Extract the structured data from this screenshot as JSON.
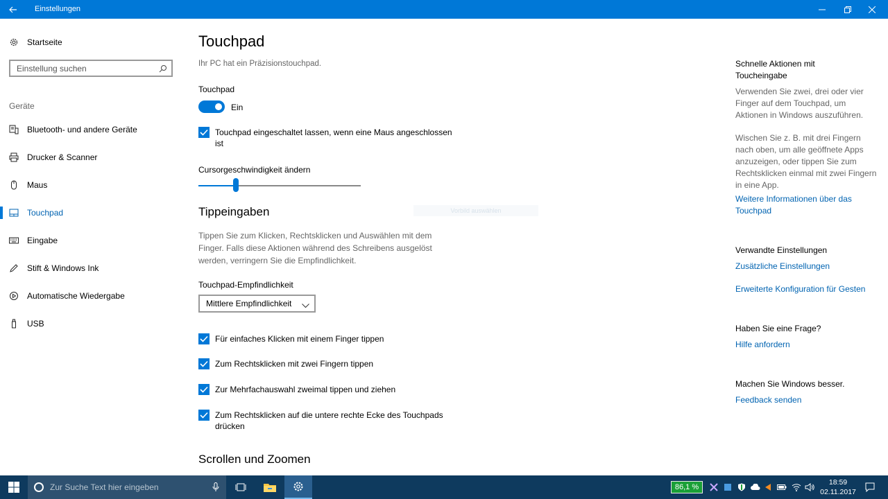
{
  "window": {
    "title": "Einstellungen"
  },
  "sidebar": {
    "home": "Startseite",
    "search_placeholder": "Einstellung suchen",
    "section": "Geräte",
    "items": [
      {
        "label": "Bluetooth- und andere Geräte",
        "icon": "bluetooth-devices-icon"
      },
      {
        "label": "Drucker & Scanner",
        "icon": "printer-icon"
      },
      {
        "label": "Maus",
        "icon": "mouse-icon"
      },
      {
        "label": "Touchpad",
        "icon": "touchpad-icon",
        "active": true
      },
      {
        "label": "Eingabe",
        "icon": "keyboard-icon"
      },
      {
        "label": "Stift & Windows Ink",
        "icon": "pen-icon"
      },
      {
        "label": "Automatische Wiedergabe",
        "icon": "autoplay-icon"
      },
      {
        "label": "USB",
        "icon": "usb-icon"
      }
    ]
  },
  "main": {
    "title": "Touchpad",
    "subtitle": "Ihr PC hat ein Präzisionstouchpad.",
    "touchpad_label": "Touchpad",
    "toggle_state": "Ein",
    "keep_on_label": "Touchpad eingeschaltet lassen, wenn eine Maus angeschlossen ist",
    "cursor_speed_label": "Cursorgeschwindigkeit ändern",
    "cursor_speed_value": 0.23,
    "tap_heading": "Tippeingaben",
    "tap_description": "Tippen Sie zum Klicken, Rechtsklicken und Auswählen mit dem Finger. Falls diese Aktionen während des Schreibens ausgelöst werden, verringern Sie die Empfindlichkeit.",
    "sensitivity_label": "Touchpad-Empfindlichkeit",
    "sensitivity_value": "Mittlere Empfindlichkeit",
    "ghost_text": "Vorbild auswählen",
    "checkboxes": [
      "Für einfaches Klicken mit einem Finger tippen",
      "Zum Rechtsklicken mit zwei Fingern tippen",
      "Zur Mehrfachauswahl zweimal tippen und ziehen",
      "Zum Rechtsklicken auf die untere rechte Ecke des Touchpads drücken"
    ],
    "scroll_heading": "Scrollen und Zoomen"
  },
  "right": {
    "quick_heading": "Schnelle Aktionen mit Toucheingabe",
    "quick_p1": "Verwenden Sie zwei, drei oder vier Finger auf dem Touchpad, um Aktionen in Windows auszuführen.",
    "quick_p2": "Wischen Sie z. B. mit drei Fingern nach oben, um alle geöffnete Apps anzuzeigen, oder tippen Sie zum Rechtsklicken einmal mit zwei Fingern in eine App.",
    "quick_link": "Weitere Informationen über das Touchpad",
    "related_heading": "Verwandte Einstellungen",
    "related_link1": "Zusätzliche Einstellungen",
    "related_link2": "Erweiterte Konfiguration für Gesten",
    "question_heading": "Haben Sie eine Frage?",
    "question_link": "Hilfe anfordern",
    "improve_heading": "Machen Sie Windows besser.",
    "improve_link": "Feedback senden"
  },
  "taskbar": {
    "search_placeholder": "Zur Suche Text hier eingeben",
    "battery": "86,1 %",
    "time": "18:59",
    "date": "02.11.2017"
  },
  "colors": {
    "accent": "#0078d7",
    "link": "#0063b1",
    "taskbar": "#0e3a5e",
    "battery": "#1aa037"
  }
}
